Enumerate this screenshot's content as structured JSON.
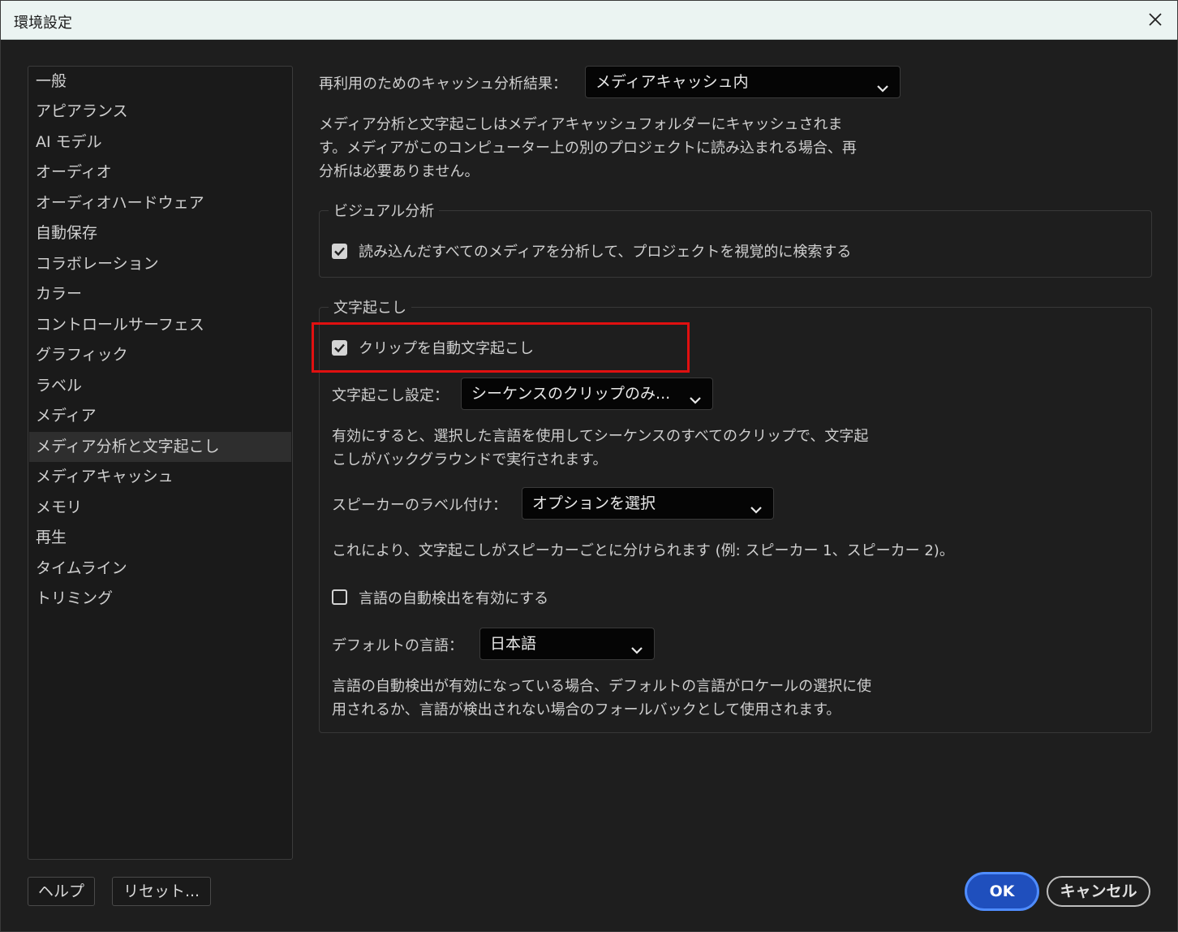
{
  "window": {
    "title": "環境設定"
  },
  "sidebar": {
    "items": [
      {
        "label": "一般"
      },
      {
        "label": "アピアランス"
      },
      {
        "label": "AI モデル"
      },
      {
        "label": "オーディオ"
      },
      {
        "label": "オーディオハードウェア"
      },
      {
        "label": "自動保存"
      },
      {
        "label": "コラボレーション"
      },
      {
        "label": "カラー"
      },
      {
        "label": "コントロールサーフェス"
      },
      {
        "label": "グラフィック"
      },
      {
        "label": "ラベル"
      },
      {
        "label": "メディア"
      },
      {
        "label": "メディア分析と文字起こし",
        "selected": true
      },
      {
        "label": "メディアキャッシュ"
      },
      {
        "label": "メモリ"
      },
      {
        "label": "再生"
      },
      {
        "label": "タイムライン"
      },
      {
        "label": "トリミング"
      }
    ]
  },
  "cache": {
    "label": "再利用のためのキャッシュ分析結果：",
    "value": "メディアキャッシュ内",
    "desc_line1": "メディア分析と文字起こしはメディアキャッシュフォルダーにキャッシュされま",
    "desc_line2": "す。メディアがこのコンピューター上の別のプロジェクトに読み込まれる場合、再",
    "desc_line3": "分析は必要ありません。"
  },
  "visual": {
    "title": "ビジュアル分析",
    "checkbox_label": "読み込んだすべてのメディアを分析して、プロジェクトを視覚的に検索する",
    "checked": true
  },
  "transcription": {
    "title": "文字起こし",
    "auto_label": "クリップを自動文字起こし",
    "auto_checked": true,
    "settings_label": "文字起こし設定：",
    "settings_value": "シーケンスのクリップのみ...",
    "settings_desc_line1": "有効にすると、選択した言語を使用してシーケンスのすべてのクリップで、文字起",
    "settings_desc_line2": "こしがバックグラウンドで実行されます。",
    "speaker_label": "スピーカーのラベル付け：",
    "speaker_value": "オプションを選択",
    "speaker_desc": "これにより、文字起こしがスピーカーごとに分けられます (例: スピーカー 1、スピーカー 2)。",
    "autodetect_label": "言語の自動検出を有効にする",
    "autodetect_checked": false,
    "default_lang_label": "デフォルトの言語：",
    "default_lang_value": "日本語",
    "lang_desc_line1": "言語の自動検出が有効になっている場合、デフォルトの言語がロケールの選択に使",
    "lang_desc_line2": "用されるか、言語が検出されない場合のフォールバックとして使用されます。"
  },
  "footer": {
    "help": "ヘルプ",
    "reset": "リセット...",
    "ok": "OK",
    "cancel": "キャンセル"
  },
  "colors": {
    "highlight": "#e01010",
    "ok_button": "#1f4fbd",
    "background": "#1e1e1e"
  }
}
